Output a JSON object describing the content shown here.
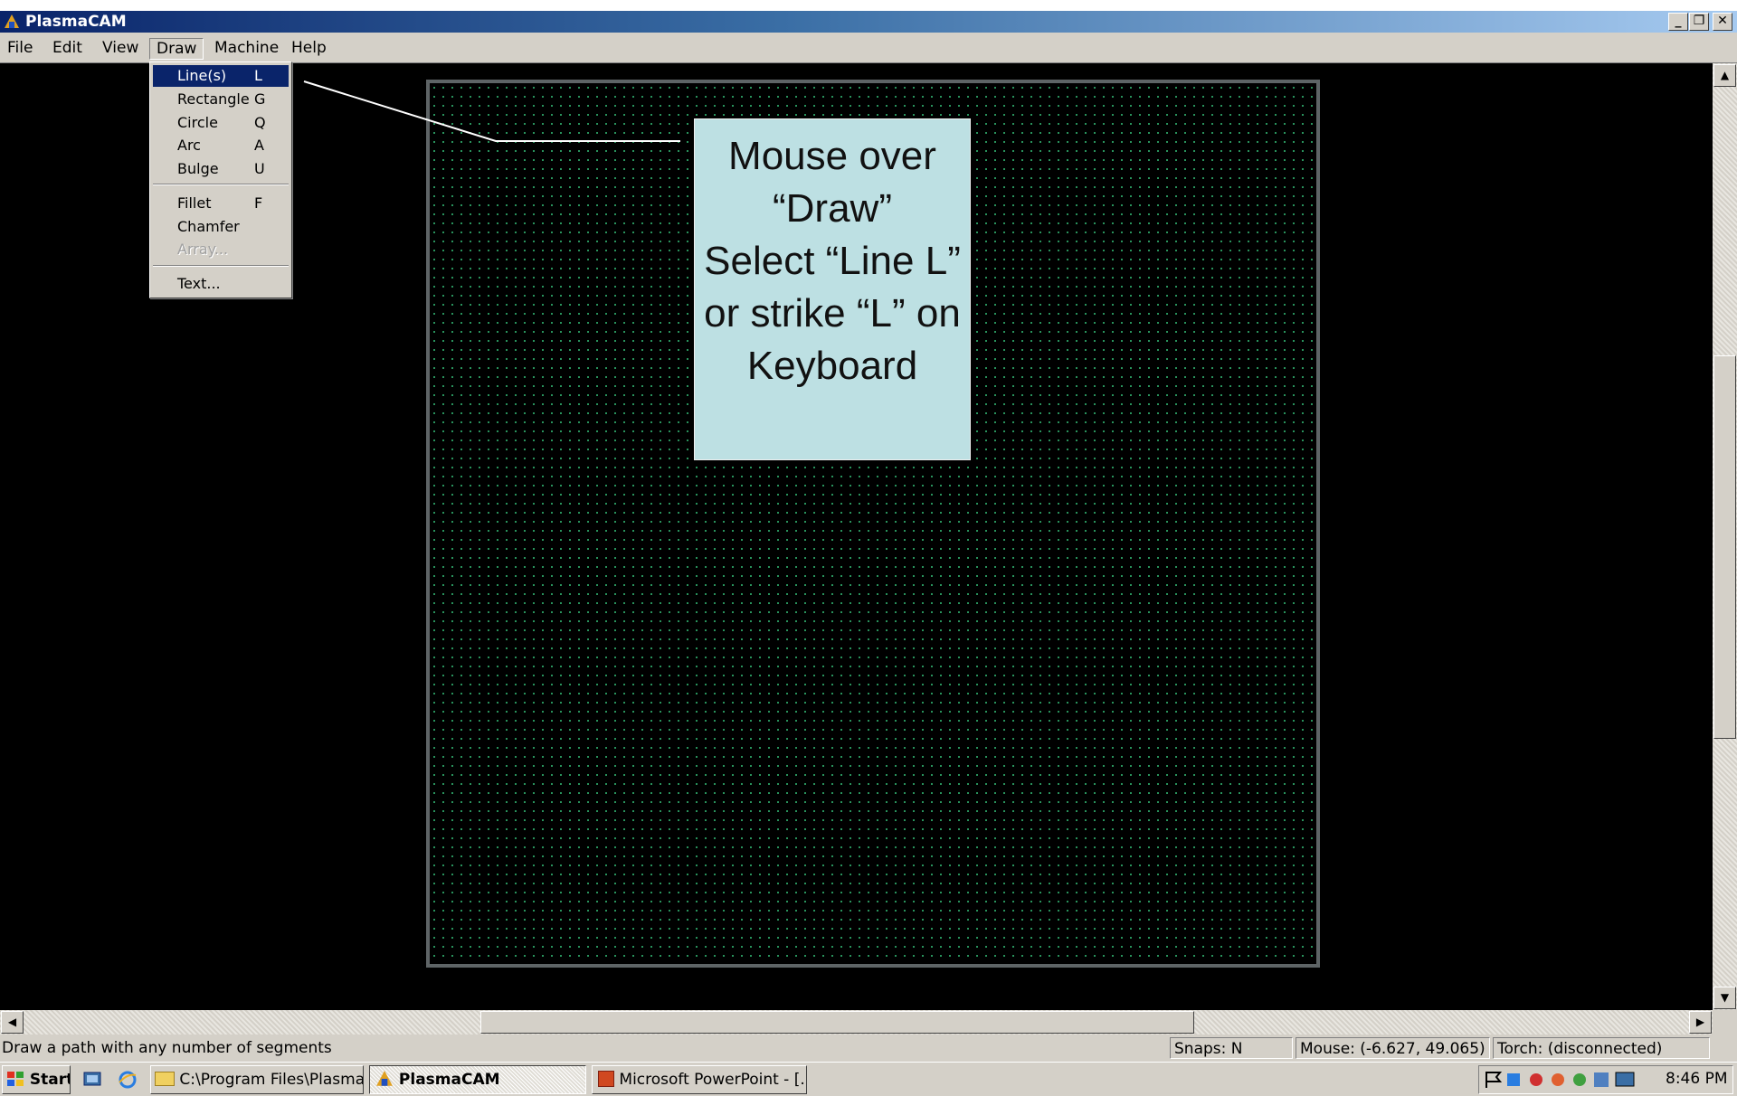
{
  "window": {
    "title": "PlasmaCAM"
  },
  "menubar": {
    "items": [
      "File",
      "Edit",
      "View",
      "Draw",
      "Machine",
      "Help"
    ]
  },
  "draw_menu": {
    "items": [
      {
        "label": "Line(s)",
        "key": "L"
      },
      {
        "label": "Rectangle",
        "key": "G"
      },
      {
        "label": "Circle",
        "key": "Q"
      },
      {
        "label": "Arc",
        "key": "A"
      },
      {
        "label": "Bulge",
        "key": "U"
      },
      {
        "label": "Fillet",
        "key": "F"
      },
      {
        "label": "Chamfer",
        "key": ""
      },
      {
        "label": "Array...",
        "key": ""
      },
      {
        "label": "Text...",
        "key": ""
      }
    ]
  },
  "annotation": {
    "text": "Mouse over “Draw”\nSelect “Line L”  or strike “L” on Keyboard"
  },
  "status": {
    "hint": "Draw a path with any number of segments",
    "snaps": "Snaps:  N",
    "mouse": "Mouse:  (-6.627, 49.065)",
    "torch": "Torch: (disconnected)"
  },
  "taskbar": {
    "start": "Start",
    "tasks": [
      "C:\\Program Files\\Plasma...",
      "PlasmaCAM",
      "Microsoft PowerPoint - [..."
    ],
    "clock": "8:46 PM"
  },
  "colors": {
    "titlebar": "#0a246a",
    "canvas": "#000000",
    "grid_dots": "#2fa86a",
    "callout": "#bde0e3",
    "menu_highlight": "#0a246a"
  },
  "icons": [
    "plasmacam-app-icon",
    "minimize-icon",
    "restore-icon",
    "close-icon",
    "scroll-up-arrow-icon",
    "scroll-down-arrow-icon",
    "scroll-left-arrow-icon",
    "scroll-right-arrow-icon",
    "windows-logo-icon",
    "show-desktop-icon",
    "internet-explorer-icon",
    "folder-icon",
    "powerpoint-icon",
    "tray-icons"
  ]
}
